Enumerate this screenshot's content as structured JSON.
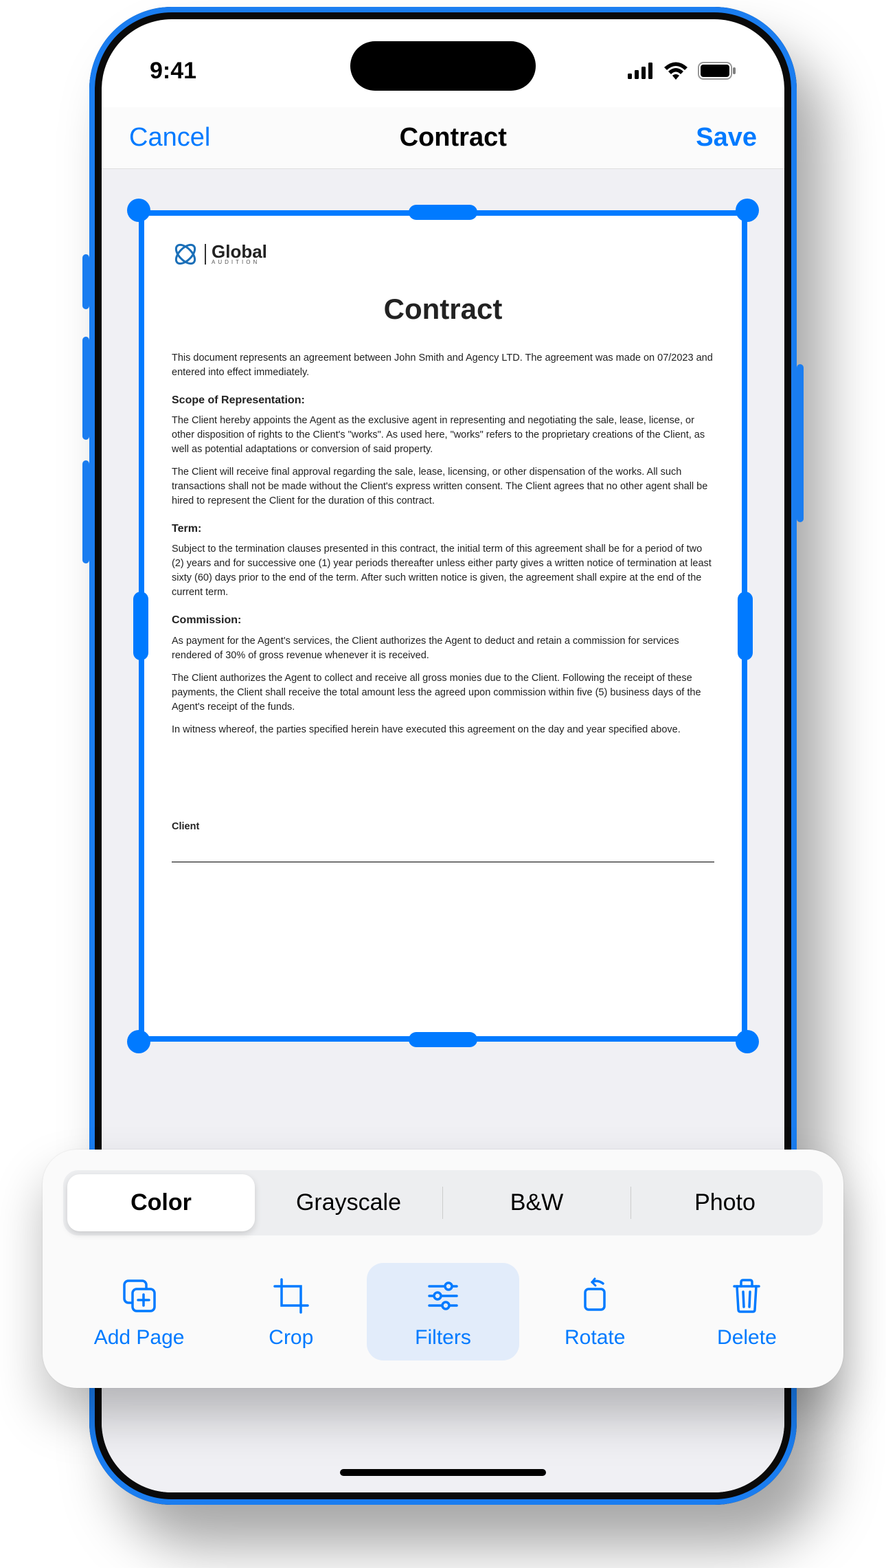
{
  "status": {
    "time": "9:41"
  },
  "nav": {
    "cancel": "Cancel",
    "title": "Contract",
    "save": "Save"
  },
  "document": {
    "logo_main": "Global",
    "logo_sub": "AUDITION",
    "title": "Contract",
    "intro": "This document represents an agreement between John Smith and Agency LTD. The agreement was made on 07/2023 and entered into effect immediately.",
    "h_scope": "Scope of Representation:",
    "scope_p1": "The Client hereby appoints the Agent as the exclusive agent in representing and negotiating the sale, lease, license, or other disposition of rights to the Client's \"works\". As used here, \"works\" refers to the proprietary creations of the Client, as well as potential adaptations or conversion of said property.",
    "scope_p2": "The Client will receive final approval regarding the sale, lease, licensing, or other dispensation of the works. All such transactions shall not be made without the Client's express written consent. The Client agrees that no other agent shall be hired to represent the Client for the duration of this contract.",
    "h_term": "Term:",
    "term_p1": "Subject to the termination clauses presented in this contract, the initial term of this agreement shall be for a period of two (2) years and for successive one (1) year periods thereafter unless either party gives a written notice of termination at least sixty (60) days prior to the end of the term. After such written notice is given, the agreement shall expire at the end of the current term.",
    "h_commission": "Commission:",
    "comm_p1": "As payment for the Agent's services, the Client authorizes the Agent to deduct and retain a commission for services rendered of 30% of gross revenue whenever it is received.",
    "comm_p2": "The Client authorizes the Agent to collect and receive all gross monies due to the Client. Following the receipt of these payments, the Client shall receive the total amount less the agreed upon commission within five (5) business days of the Agent's receipt of the funds.",
    "witness": "In witness whereof, the parties specified herein have executed this agreement on the day and year specified above.",
    "sig_label": "Client"
  },
  "filters": {
    "opt1": "Color",
    "opt2": "Grayscale",
    "opt3": "B&W",
    "opt4": "Photo"
  },
  "tools": {
    "add_page": "Add Page",
    "crop": "Crop",
    "filters": "Filters",
    "rotate": "Rotate",
    "delete": "Delete"
  }
}
